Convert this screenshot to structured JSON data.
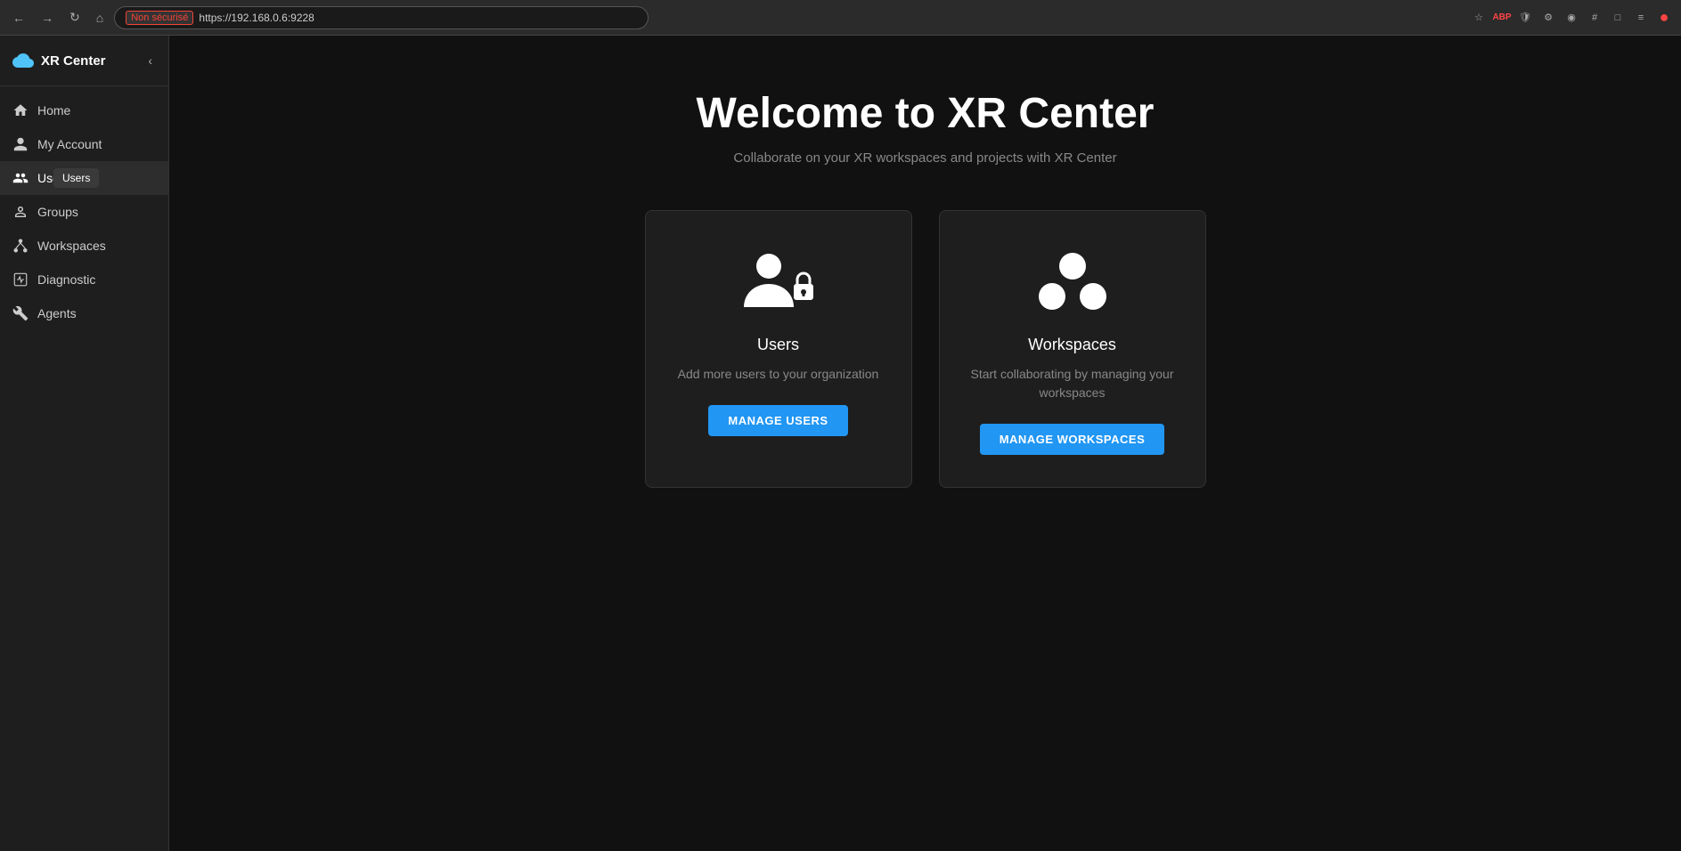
{
  "browser": {
    "insecure_label": "Non sécurisé",
    "url": "https://192.168.0.6:9228",
    "nav_back": "←",
    "nav_forward": "→",
    "nav_reload": "↻",
    "nav_home": "⌂"
  },
  "sidebar": {
    "title": "XR Center",
    "collapse_icon": "‹",
    "items": [
      {
        "id": "home",
        "label": "Home",
        "icon": "home"
      },
      {
        "id": "my-account",
        "label": "My Account",
        "icon": "person"
      },
      {
        "id": "users",
        "label": "Users",
        "icon": "people",
        "active": true
      },
      {
        "id": "groups",
        "label": "Groups",
        "icon": "group"
      },
      {
        "id": "workspaces",
        "label": "Workspaces",
        "icon": "workspaces"
      },
      {
        "id": "diagnostic",
        "label": "Diagnostic",
        "icon": "diagnostic"
      },
      {
        "id": "agents",
        "label": "Agents",
        "icon": "agents"
      }
    ],
    "tooltip": "Users"
  },
  "main": {
    "welcome_title": "Welcome to XR Center",
    "welcome_subtitle": "Collaborate on your XR workspaces and projects with XR Center",
    "cards": [
      {
        "id": "users-card",
        "title": "Users",
        "description": "Add more users to your organization",
        "button_label": "MANAGE USERS"
      },
      {
        "id": "workspaces-card",
        "title": "Workspaces",
        "description": "Start collaborating by managing your workspaces",
        "button_label": "MANAGE WORKSPACES"
      }
    ]
  }
}
